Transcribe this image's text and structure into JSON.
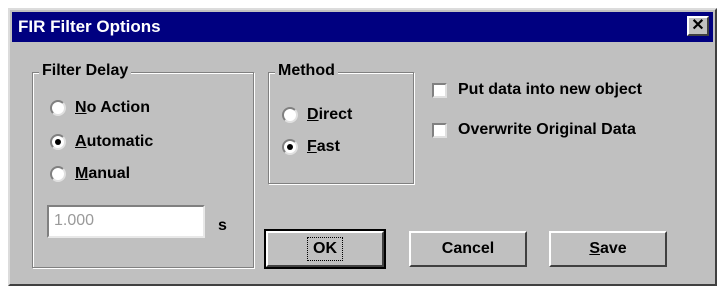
{
  "window": {
    "title": "FIR Filter Options",
    "close_glyph": "✕"
  },
  "filter_delay": {
    "label": "Filter Delay",
    "options": [
      {
        "mnemonic": "N",
        "rest": "o Action",
        "checked": false
      },
      {
        "mnemonic": "A",
        "rest": "utomatic",
        "checked": true
      },
      {
        "mnemonic": "M",
        "rest": "anual",
        "checked": false
      }
    ],
    "value": "1.000",
    "unit": "s"
  },
  "method": {
    "label": "Method",
    "options": [
      {
        "mnemonic": "D",
        "rest": "irect",
        "checked": false
      },
      {
        "mnemonic": "F",
        "rest": "ast",
        "checked": true
      }
    ]
  },
  "checkboxes": {
    "new_object": {
      "label": "Put data into new object",
      "checked": false
    },
    "overwrite": {
      "label": "Overwrite Original Data",
      "checked": false
    }
  },
  "buttons": {
    "ok": "OK",
    "cancel": "Cancel",
    "save_mnemonic": "S",
    "save_rest": "ave"
  }
}
